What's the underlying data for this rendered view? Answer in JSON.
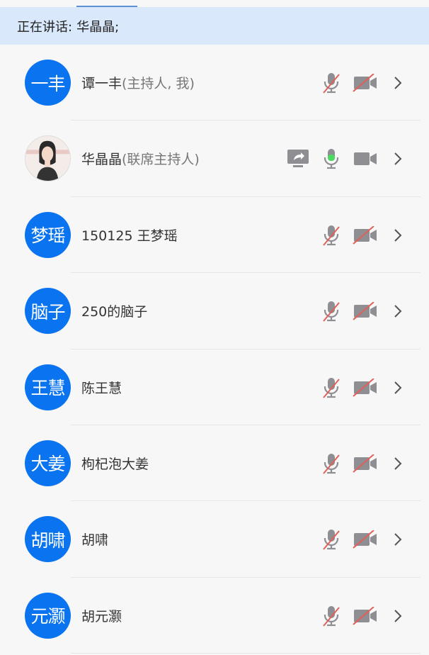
{
  "speaking": {
    "label": "正在讲话:",
    "name": "华晶晶;"
  },
  "participants": [
    {
      "avatar_text": "一丰",
      "name": "谭一丰",
      "role": "(主持人, 我)",
      "mic": "muted",
      "camera": "off",
      "sharing": false
    },
    {
      "avatar_text": "",
      "name": "华晶晶",
      "role": "(联席主持人)",
      "mic": "active",
      "camera": "on",
      "sharing": true,
      "photo": true
    },
    {
      "avatar_text": "梦瑶",
      "name": "150125 王梦瑶",
      "role": "",
      "mic": "muted",
      "camera": "off",
      "sharing": false
    },
    {
      "avatar_text": "脑子",
      "name": "250的脑子",
      "role": "",
      "mic": "muted",
      "camera": "off",
      "sharing": false
    },
    {
      "avatar_text": "王慧",
      "name": "陈王慧",
      "role": "",
      "mic": "muted",
      "camera": "off",
      "sharing": false
    },
    {
      "avatar_text": "大姜",
      "name": "枸杞泡大姜",
      "role": "",
      "mic": "muted",
      "camera": "off",
      "sharing": false
    },
    {
      "avatar_text": "胡啸",
      "name": "胡啸",
      "role": "",
      "mic": "muted",
      "camera": "off",
      "sharing": false
    },
    {
      "avatar_text": "元灏",
      "name": "胡元灏",
      "role": "",
      "mic": "muted",
      "camera": "off",
      "sharing": false
    }
  ],
  "colors": {
    "avatar_bg": "#0a74f0",
    "speaking_bar": "#d9e8fb",
    "mute_slash": "#e0605a",
    "mic_active": "#4cd964",
    "icon_gray": "#8e8e93"
  }
}
